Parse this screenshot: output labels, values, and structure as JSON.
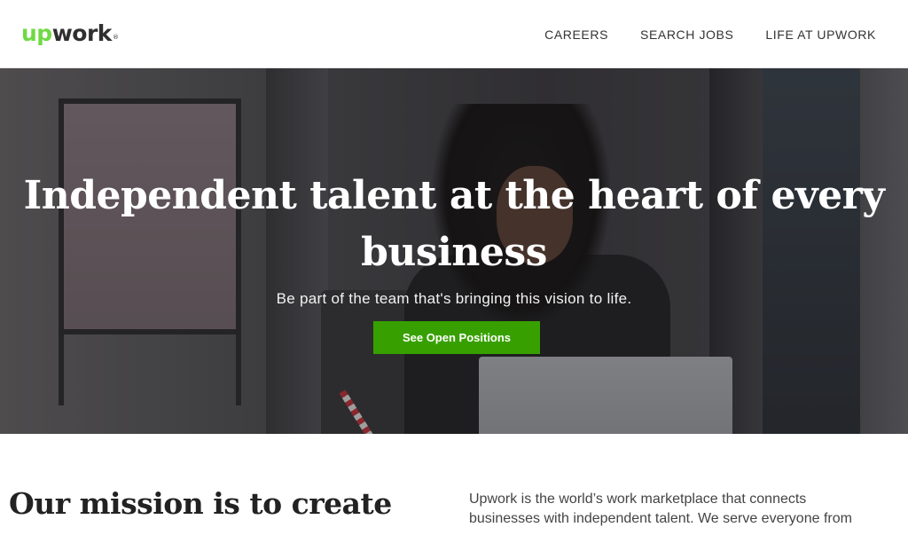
{
  "header": {
    "logo_up": "up",
    "logo_work": "work",
    "logo_tm": "®",
    "nav": [
      {
        "label": "CAREERS"
      },
      {
        "label": "SEARCH JOBS"
      },
      {
        "label": "LIFE AT UPWORK"
      }
    ]
  },
  "hero": {
    "title_line1": "Independent talent at the heart of every",
    "title_line2": "business",
    "subtitle": "Be part of the team that's bringing this vision to life.",
    "cta_label": "See Open Positions"
  },
  "mission": {
    "heading": "Our mission is to create",
    "text_line1": "Upwork is the world’s work marketplace that connects",
    "text_line2": "businesses with independent talent. We serve everyone from"
  },
  "colors": {
    "brand_green": "#6fda44",
    "cta_green": "#37a000"
  }
}
